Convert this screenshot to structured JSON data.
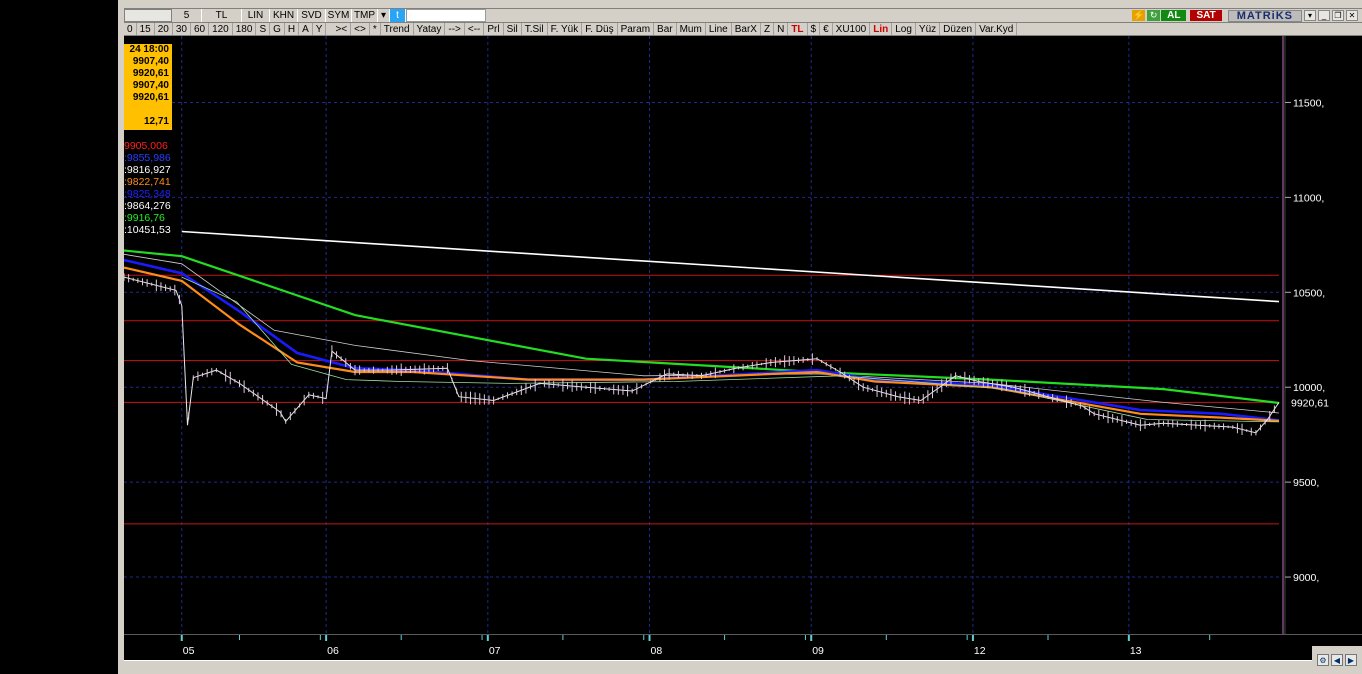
{
  "toolbar_top": {
    "cells": [
      "5",
      "TL",
      "LIN",
      "KHN",
      "SVD",
      "SYM",
      "TMP"
    ],
    "al_label": "AL",
    "sat_label": "SAT",
    "brand": "MATRiKS"
  },
  "toolbar_periods": [
    "0",
    "15",
    "20",
    "30",
    "60",
    "120",
    "180",
    "S",
    "G",
    "H",
    "A",
    "Y"
  ],
  "toolbar_actions": [
    ">< ",
    "<>",
    "*",
    "Trend",
    "Yatay",
    "-->",
    "<--",
    "Prl",
    "Sil",
    "T.Sil",
    "F. Yük",
    "F. Düş",
    "Param",
    "Bar",
    "Mum",
    "Line",
    "BarX",
    "Z",
    "N",
    "TL",
    "$",
    "€",
    "XU100",
    "Lin",
    "Log",
    "Yüz",
    "Düzen",
    "Var.Kyd"
  ],
  "info_box": {
    "date": "24 18:00",
    "open": "9907,40",
    "high": "9920,61",
    "low": "9907,40",
    "close": "9920,61",
    "volume": "12,71"
  },
  "indicators": [
    {
      "text": "9905,006",
      "color": "#ff2020"
    },
    {
      "text": ":9855,986",
      "color": "#2a3cff"
    },
    {
      "text": ":9816,927",
      "color": "#ffffff"
    },
    {
      "text": ":9822,741",
      "color": "#ff8c1a"
    },
    {
      "text": ":9825,348",
      "color": "#2020ff"
    },
    {
      "text": ":9864,276",
      "color": "#ffffff"
    },
    {
      "text": ":9916,76",
      "color": "#22ee22"
    },
    {
      "text": ":10451,53",
      "color": "#ffffff"
    }
  ],
  "colors": {
    "white_line": "#ffffff",
    "green_line": "#22dd22",
    "blue_line": "#1a1aff",
    "orange_line": "#ff8c1a",
    "red_level": "#c81414",
    "grid": "#1f2a8c",
    "price_bars": "#e8e8e8",
    "axis_text": "#ffffff"
  },
  "chart_data": {
    "type": "line",
    "y_ticks": [
      "11500,",
      "11000,",
      "10500,",
      "10000,",
      "9500,",
      "9000,"
    ],
    "last_price_label": "9920,61",
    "x_labels": [
      "05",
      "06",
      "07",
      "08",
      "09",
      "12",
      "13"
    ],
    "ylim": [
      8700,
      11850
    ],
    "red_levels": [
      10590,
      10350,
      10140,
      9920,
      9280
    ],
    "series": [
      {
        "key": "white",
        "x": [
          0,
          1
        ],
        "values": [
          10820,
          10451
        ]
      },
      {
        "key": "green",
        "x": [
          0,
          0.05,
          0.2,
          0.4,
          0.6,
          0.75,
          0.9,
          1
        ],
        "values": [
          10720,
          10690,
          10380,
          10150,
          10080,
          10040,
          9990,
          9917
        ]
      },
      {
        "key": "black_white_ma",
        "x": [
          0,
          0.05,
          0.13,
          0.2,
          0.3,
          0.45,
          0.6,
          0.75,
          0.9,
          1
        ],
        "values": [
          10700,
          10650,
          10300,
          10220,
          10140,
          10060,
          10070,
          10020,
          9920,
          9864
        ]
      },
      {
        "key": "blue",
        "x": [
          0,
          0.05,
          0.1,
          0.15,
          0.2,
          0.25,
          0.35,
          0.45,
          0.6,
          0.65,
          0.75,
          0.88,
          0.95,
          1
        ],
        "values": [
          10670,
          10600,
          10400,
          10180,
          10100,
          10090,
          10040,
          10040,
          10090,
          10040,
          10010,
          9880,
          9860,
          9825
        ]
      },
      {
        "key": "orange",
        "x": [
          0,
          0.05,
          0.1,
          0.15,
          0.2,
          0.25,
          0.35,
          0.45,
          0.6,
          0.65,
          0.75,
          0.88,
          0.95,
          1
        ],
        "values": [
          10630,
          10560,
          10330,
          10130,
          10080,
          10080,
          10040,
          10040,
          10080,
          10030,
          10000,
          9860,
          9840,
          9823
        ]
      },
      {
        "key": "thin_white",
        "x": [
          0,
          0.05,
          0.1,
          0.15,
          0.2,
          0.3,
          0.45,
          0.6,
          0.75,
          0.88,
          1
        ],
        "values": [
          10580,
          10450,
          10120,
          10040,
          10030,
          10020,
          10030,
          10060,
          9990,
          9830,
          9817
        ]
      },
      {
        "key": "price",
        "x": [
          0,
          0.045,
          0.05,
          0.055,
          0.06,
          0.08,
          0.1,
          0.135,
          0.14,
          0.16,
          0.175,
          0.18,
          0.2,
          0.23,
          0.28,
          0.29,
          0.32,
          0.36,
          0.4,
          0.44,
          0.47,
          0.5,
          0.53,
          0.56,
          0.6,
          0.62,
          0.64,
          0.67,
          0.69,
          0.72,
          0.74,
          0.77,
          0.8,
          0.83,
          0.84,
          0.86,
          0.88,
          0.9,
          0.93,
          0.96,
          0.98,
          0.99,
          1
        ],
        "values": [
          10580,
          10510,
          10430,
          9800,
          10050,
          10090,
          10020,
          9870,
          9820,
          9960,
          9940,
          10190,
          10090,
          10090,
          10100,
          9950,
          9930,
          10020,
          10000,
          9980,
          10070,
          10060,
          10100,
          10130,
          10150,
          10080,
          10000,
          9950,
          9930,
          10060,
          10030,
          10000,
          9950,
          9900,
          9860,
          9830,
          9800,
          9810,
          9800,
          9790,
          9760,
          9830,
          9920
        ]
      }
    ]
  }
}
